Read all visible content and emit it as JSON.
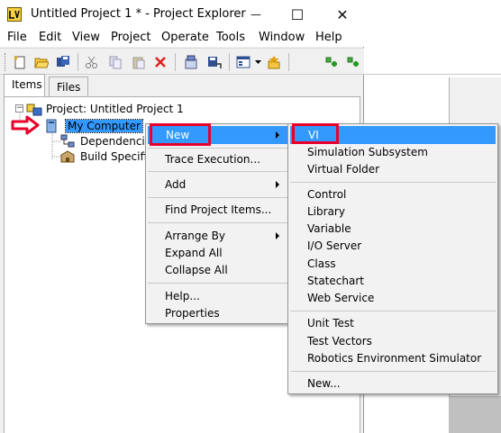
{
  "window": {
    "title": "Untitled Project 1 * - Project Explorer",
    "controls": {
      "minimize": "—",
      "maximize": "☐",
      "close": "✕"
    }
  },
  "menubar": [
    "File",
    "Edit",
    "View",
    "Project",
    "Operate",
    "Tools",
    "Window",
    "Help"
  ],
  "toolbar": {
    "icons": [
      "new-icon",
      "open-icon",
      "save-all-icon",
      "cut-icon",
      "copy-icon",
      "paste-icon",
      "delete-icon",
      "properties-icon",
      "save-build-icon",
      "view-dropdown-icon",
      "add-files-icon",
      "expand-all-icon",
      "collapse-all-icon"
    ]
  },
  "tabs": [
    {
      "label": "Items",
      "active": true
    },
    {
      "label": "Files",
      "active": false
    }
  ],
  "tree": {
    "project": "Project: Untitled Project 1",
    "my_computer": "My Computer",
    "dependencies": "Dependencies",
    "build_specs": "Build Specifications"
  },
  "context_menu": {
    "items": [
      "New",
      "Trace Execution...",
      "Add",
      "Find Project Items...",
      "Arrange By",
      "Expand All",
      "Collapse All",
      "Help...",
      "Properties"
    ]
  },
  "submenu": {
    "items": [
      "VI",
      "Simulation Subsystem",
      "Virtual Folder",
      "Control",
      "Library",
      "Variable",
      "I/O Server",
      "Class",
      "Statechart",
      "Web Service",
      "Unit Test",
      "Test Vectors",
      "Robotics Environment Simulator",
      "New..."
    ]
  },
  "colors": {
    "selection": "#3399ff",
    "annotation_red": "#e8002a"
  }
}
